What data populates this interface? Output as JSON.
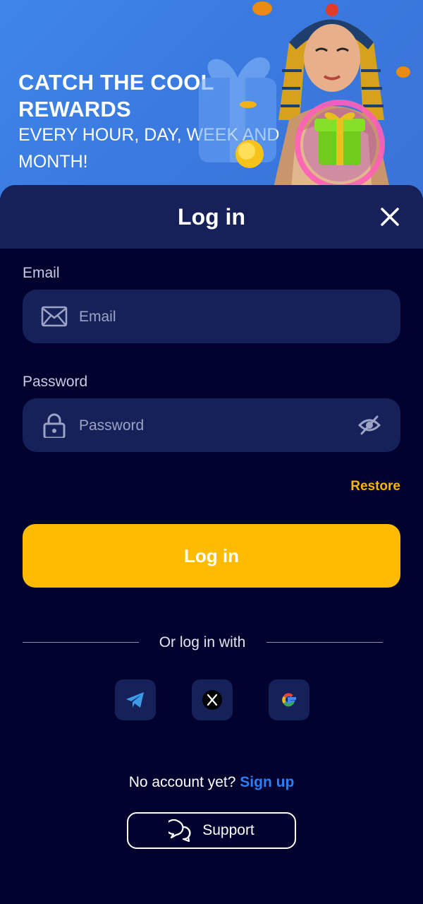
{
  "banner": {
    "title": "CATCH THE COOL REWARDS",
    "subtitle": "EVERY HOUR, DAY, WEEK AND MONTH!"
  },
  "modal": {
    "title": "Log in",
    "close_icon": "close-icon"
  },
  "email": {
    "label": "Email",
    "placeholder": "Email",
    "value": "",
    "icon": "envelope-icon"
  },
  "password": {
    "label": "Password",
    "placeholder": "Password",
    "value": "",
    "icon": "lock-icon",
    "toggle_icon": "eye-off-icon"
  },
  "restore_label": "Restore",
  "login_button_label": "Log in",
  "social": {
    "divider_text": "Or log in with",
    "providers": [
      "telegram-icon",
      "x-icon",
      "google-icon"
    ]
  },
  "signup": {
    "prompt": "No account yet?",
    "link": "Sign up"
  },
  "support_label": "Support",
  "colors": {
    "accent": "#ffbb00",
    "link": "#2c7ef2",
    "restore": "#f5b50a",
    "panel": "#16215a",
    "background": "#01022e"
  }
}
